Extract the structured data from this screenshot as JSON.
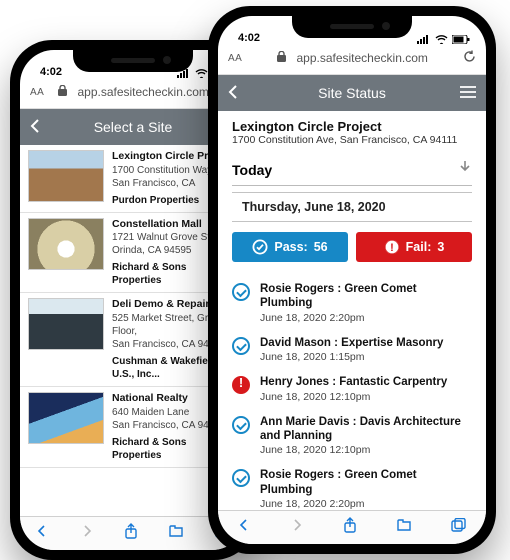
{
  "left_phone": {
    "status_time": "4:02",
    "url_aa": "AA",
    "url_host": "app.safesitecheckin.com",
    "header_title": "Select a Site",
    "sites": [
      {
        "name": "Lexington Circle Project",
        "addr1": "1700 Constitution Way",
        "addr2": "San Francisco, CA",
        "owner": "Purdon Properties"
      },
      {
        "name": "Constellation Mall",
        "addr1": "1721 Walnut Grove Street",
        "addr2": "Orinda, CA 94595",
        "owner": "Richard & Sons Properties"
      },
      {
        "name": "Deli Demo & Repair",
        "addr1": "525 Market Street, Ground Floor,",
        "addr2": "San Francisco, CA 94111",
        "owner": "Cushman & Wakefield U.S., Inc..."
      },
      {
        "name": "National Realty",
        "addr1": "640 Maiden Lane",
        "addr2": "San Francisco, CA 94111",
        "owner": "Richard & Sons Properties"
      }
    ]
  },
  "right_phone": {
    "status_time": "4:02",
    "url_aa": "AA",
    "url_host": "app.safesitecheckin.com",
    "header_title": "Site Status",
    "project_name": "Lexington Circle Project",
    "project_addr": "1700 Constitution Ave, San Francisco, CA 94111",
    "today_label": "Today",
    "date_label": "Thursday, June 18, 2020",
    "pass_label": "Pass:",
    "pass_count": "56",
    "fail_label": "Fail:",
    "fail_count": "3",
    "checkins": [
      {
        "status": "pass",
        "line1": "Rosie Rogers : Green Comet Plumbing",
        "line2": "June 18, 2020 2:20pm"
      },
      {
        "status": "pass",
        "line1": "David Mason : Expertise Masonry",
        "line2": "June 18, 2020 1:15pm"
      },
      {
        "status": "fail",
        "line1": "Henry Jones : Fantastic Carpentry",
        "line2": "June 18, 2020 12:10pm"
      },
      {
        "status": "pass",
        "line1": "Ann Marie Davis : Davis Architecture and Planning",
        "line2": "June 18, 2020 12:10pm"
      },
      {
        "status": "pass",
        "line1": "Rosie Rogers : Green Comet Plumbing",
        "line2": "June 18, 2020 2:20pm"
      }
    ]
  },
  "colors": {
    "pass": "#1788c6",
    "fail": "#d7191c",
    "header": "#6e767d"
  }
}
